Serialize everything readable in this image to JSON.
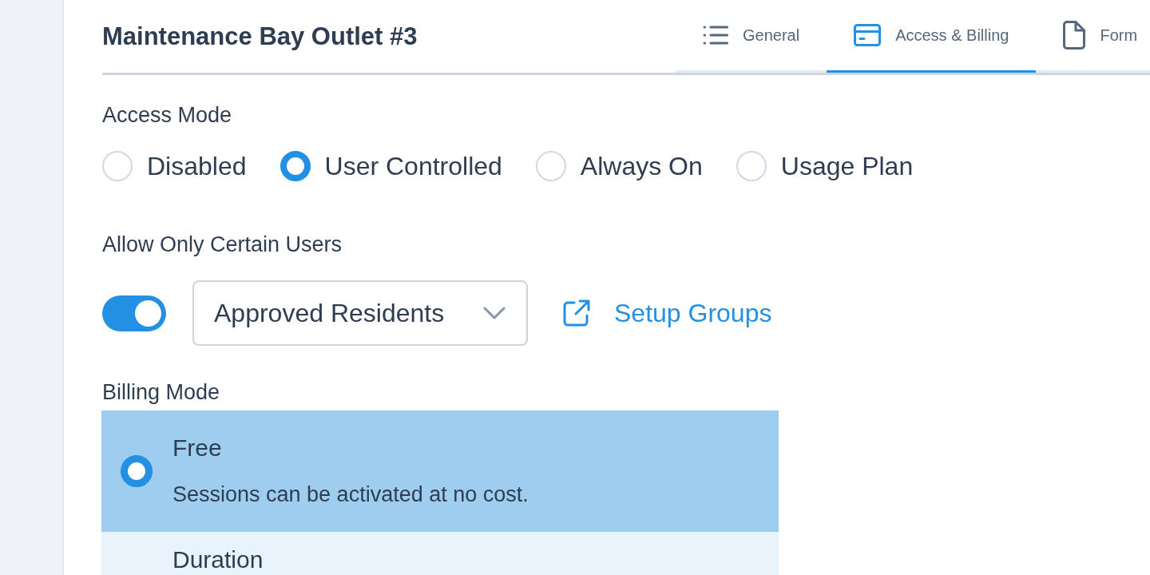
{
  "page": {
    "title": "Maintenance Bay Outlet #3"
  },
  "tabs": [
    {
      "label": "General",
      "selected": false
    },
    {
      "label": "Access & Billing",
      "selected": true
    },
    {
      "label": "Form",
      "selected": false
    }
  ],
  "access_mode": {
    "label": "Access Mode",
    "options": [
      {
        "label": "Disabled",
        "selected": false
      },
      {
        "label": "User Controlled",
        "selected": true
      },
      {
        "label": "Always On",
        "selected": false
      },
      {
        "label": "Usage Plan",
        "selected": false
      }
    ]
  },
  "allow_only_certain_users": {
    "label": "Allow Only Certain Users",
    "on": true,
    "group_select": {
      "value": "Approved Residents"
    },
    "link": "Setup Groups"
  },
  "billing_mode": {
    "label": "Billing Mode",
    "options": [
      {
        "title": "Free",
        "description": "Sessions can be activated at no cost.",
        "selected": true
      },
      {
        "title": "Duration",
        "selected": false
      }
    ]
  }
}
